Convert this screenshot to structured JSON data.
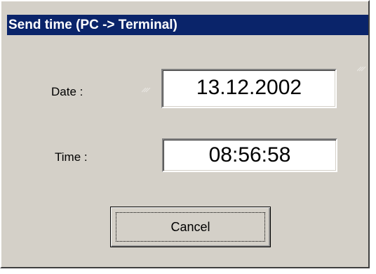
{
  "window": {
    "title": "Send time (PC -> Terminal)"
  },
  "date": {
    "label": "Date :",
    "value": "13.12.2002"
  },
  "time": {
    "label": "Time :",
    "value": "08:56:58"
  },
  "buttons": {
    "cancel_label": "Cancel"
  },
  "colors": {
    "titlebar": "#0a246a",
    "dialog_face": "#d4d0c8"
  }
}
